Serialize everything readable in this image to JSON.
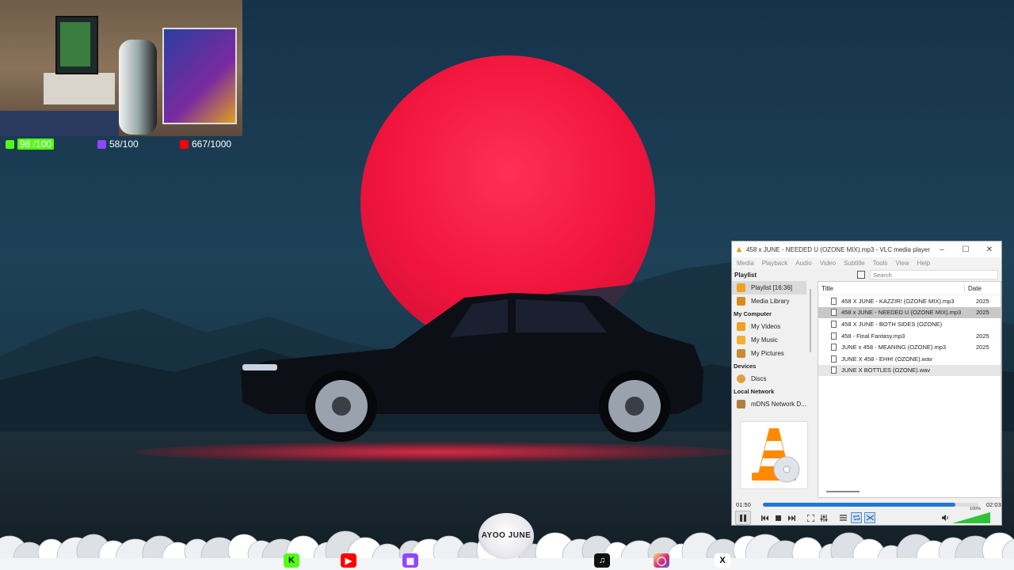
{
  "stream_goals": {
    "kick": "98 /100",
    "twitch": "58/100",
    "youtube": "667/1000"
  },
  "vlc": {
    "title": "458 x JUNE - NEEDED U (OZONE MIX).mp3 - VLC media player",
    "menu": [
      "Media",
      "Playback",
      "Audio",
      "Video",
      "Subtitle",
      "Tools",
      "View",
      "Help"
    ],
    "playlist_heading": "Playlist",
    "search_placeholder": "Search",
    "sidebar": {
      "playlist_item": "Playlist [16:36]",
      "media_library": "Media Library",
      "my_computer": "My Computer",
      "my_videos": "My Videos",
      "my_music": "My Music",
      "my_pictures": "My Pictures",
      "devices": "Devices",
      "discs": "Discs",
      "local_network": "Local Network",
      "mdns": "mDNS Network D..."
    },
    "columns": [
      "Title",
      "Date"
    ],
    "tracks": [
      {
        "title": "458 X JUNE - KAZZIR! (OZONE MIX).mp3",
        "date": "2025"
      },
      {
        "title": "458 x JUNE - NEEDED U (OZONE MIX).mp3",
        "date": "2025"
      },
      {
        "title": "458 X JUNE - BOTH SIDES (OZONE)",
        "date": ""
      },
      {
        "title": "458 - Final Fantasy.mp3",
        "date": "2025"
      },
      {
        "title": "JUNE x 458 - MEANING (OZONE).mp3",
        "date": "2025"
      },
      {
        "title": "JUNE X 458 - EHH! (OZONE).wav",
        "date": ""
      },
      {
        "title": "JUNE X BOTTLES (OZONE).wav",
        "date": ""
      }
    ],
    "elapsed": "01:50",
    "total": "02:03",
    "progress": 0.895,
    "volume_pct": "100%",
    "volume": 1.0
  },
  "logo": {
    "text": "AYOO JUNE"
  },
  "colors": {
    "sun": "#f0143d",
    "seek": "#1f78d1",
    "kick": "#53fc18",
    "twitch": "#9146ff",
    "youtube": "#ff0000",
    "instagram": "#e1306c"
  },
  "icons": [
    "kick-icon",
    "youtube-icon",
    "twitch-icon",
    "tiktok-icon",
    "instagram-icon",
    "x-icon"
  ]
}
